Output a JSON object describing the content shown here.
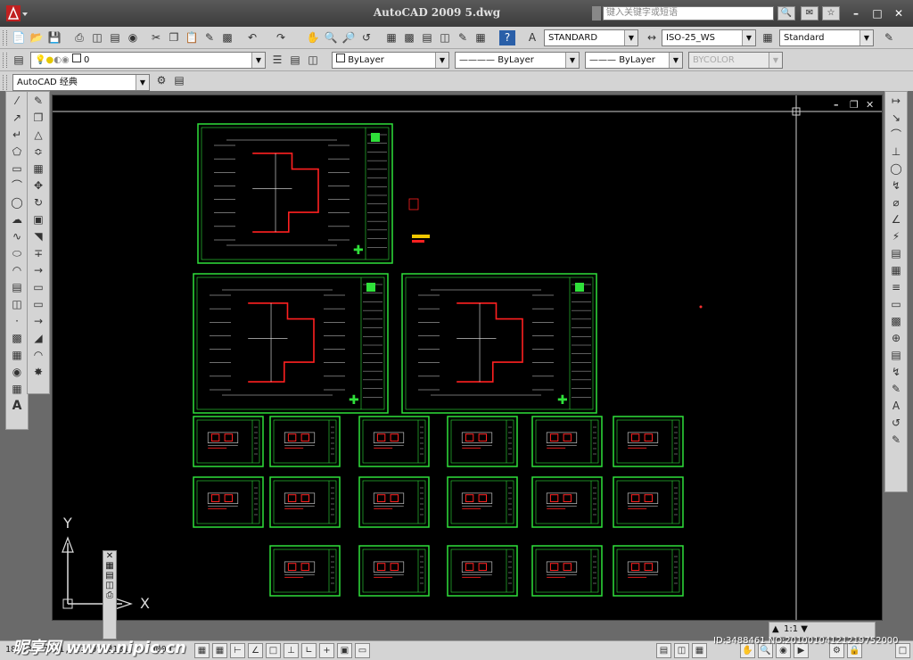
{
  "window": {
    "title": "AutoCAD 2009  5.dwg",
    "search_placeholder": "键入关键字或短语"
  },
  "toolbars": {
    "text_style": "STANDARD",
    "dim_style": "ISO-25_WS",
    "table_style": "Standard",
    "layer_name": "0",
    "color": "ByLayer",
    "linetype": "ByLayer",
    "lineweight": "ByLayer",
    "plot_style": "BYCOLOR",
    "workspace": "AutoCAD 经典"
  },
  "ucs": {
    "x_label": "X",
    "y_label": "Y"
  },
  "status": {
    "coordinates": "182536.7771, 23499.8181, 0.0000",
    "annotation_scale": "1:1"
  },
  "watermark": {
    "text": "昵享网 www.nipic.cn",
    "id_text": "ID:3488461 NO:20100104121219752000"
  },
  "colors": {
    "sheet_border": "#2fe03a",
    "walls": "#ff2020",
    "background": "#000000",
    "ui": "#d4d4d4"
  }
}
